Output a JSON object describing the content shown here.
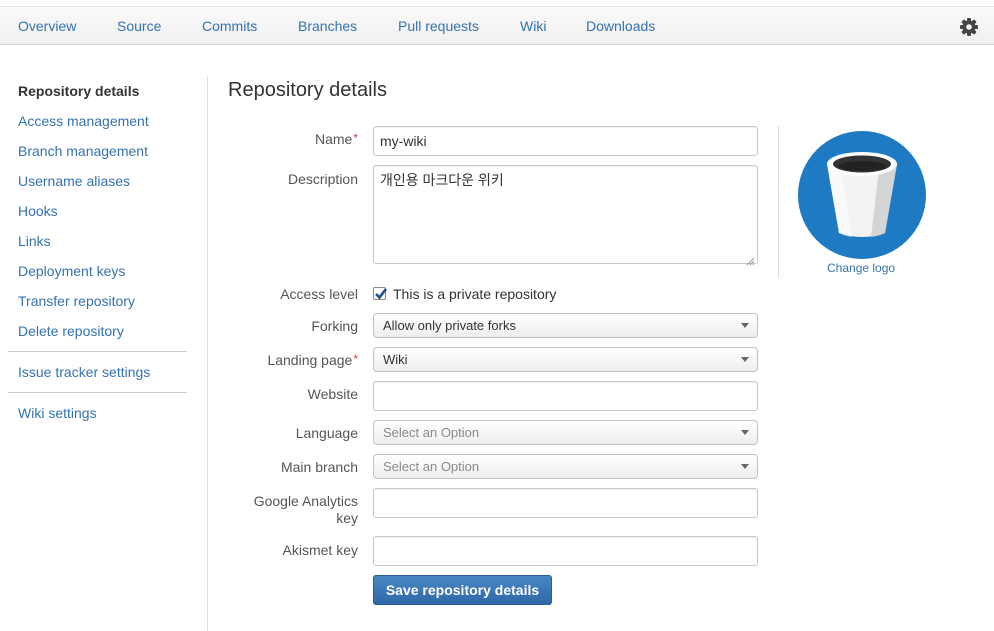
{
  "nav": {
    "tabs": [
      "Overview",
      "Source",
      "Commits",
      "Branches",
      "Pull requests",
      "Wiki",
      "Downloads"
    ],
    "settings_icon": "gear-icon"
  },
  "sidebar": {
    "items": [
      "Repository details",
      "Access management",
      "Branch management",
      "Username aliases",
      "Hooks",
      "Links",
      "Deployment keys",
      "Transfer repository",
      "Delete repository"
    ],
    "issue_tracker": "Issue tracker settings",
    "wiki_settings": "Wiki settings"
  },
  "page": {
    "title": "Repository details"
  },
  "form": {
    "name_label": "Name",
    "name_value": "my-wiki",
    "description_label": "Description",
    "description_value": "개인용 마크다운 위키",
    "access_label": "Access level",
    "private_label": "This is a private repository",
    "private_checked": true,
    "forking_label": "Forking",
    "forking_value": "Allow only private forks",
    "landing_label": "Landing page",
    "landing_value": "Wiki",
    "website_label": "Website",
    "website_value": "",
    "language_label": "Language",
    "language_value": "Select an Option",
    "main_branch_label": "Main branch",
    "main_branch_value": "Select an Option",
    "ga_label_line1": "Google Analytics",
    "ga_label_line2": "key",
    "ga_value": "",
    "akismet_label": "Akismet key",
    "akismet_value": "",
    "required_mark": "*",
    "save_label": "Save repository details"
  },
  "logo": {
    "change_label": "Change logo",
    "accent": "#1f7ac4"
  }
}
